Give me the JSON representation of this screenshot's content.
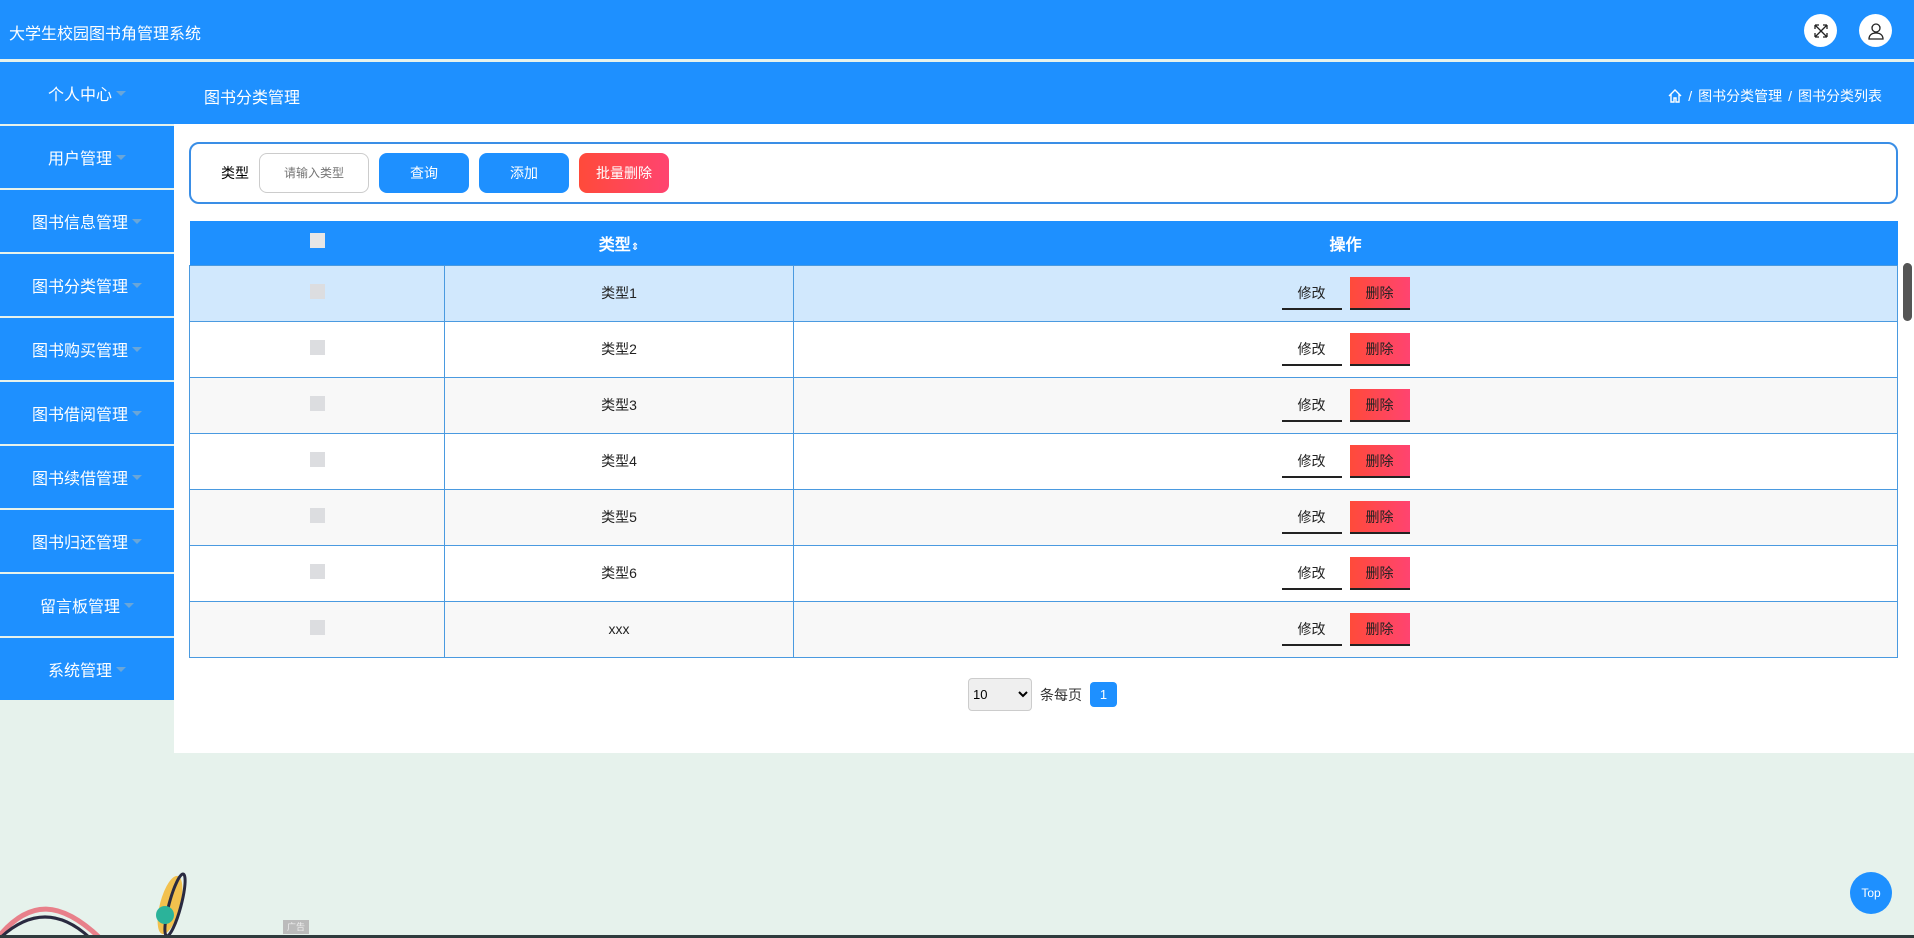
{
  "header": {
    "title": "大学生校园图书角管理系统",
    "icons": [
      "fullscreen-icon",
      "user-icon"
    ]
  },
  "subheader": {
    "page_title": "图书分类管理",
    "breadcrumb": [
      "图书分类管理",
      "图书分类列表"
    ]
  },
  "sidebar": {
    "items": [
      {
        "label": "个人中心"
      },
      {
        "label": "用户管理"
      },
      {
        "label": "图书信息管理"
      },
      {
        "label": "图书分类管理"
      },
      {
        "label": "图书购买管理"
      },
      {
        "label": "图书借阅管理"
      },
      {
        "label": "图书续借管理"
      },
      {
        "label": "图书归还管理"
      },
      {
        "label": "留言板管理"
      },
      {
        "label": "系统管理"
      }
    ]
  },
  "search": {
    "label": "类型",
    "placeholder": "请输入类型",
    "value": "",
    "query": "查询",
    "add": "添加",
    "batch_delete": "批量删除"
  },
  "table": {
    "headers": {
      "type": "类型",
      "action": "操作"
    },
    "rows": [
      {
        "type": "类型1"
      },
      {
        "type": "类型2"
      },
      {
        "type": "类型3"
      },
      {
        "type": "类型4"
      },
      {
        "type": "类型5"
      },
      {
        "type": "类型6"
      },
      {
        "type": "xxx"
      }
    ],
    "edit": "修改",
    "delete": "删除"
  },
  "pagination": {
    "page_size": "10",
    "per_page_label": "条每页",
    "current_page": "1"
  },
  "top_button": "Top",
  "ad_label": "广告",
  "colors": {
    "primary": "#1e90ff",
    "danger": "#ff4a3a",
    "background": "#e6f2ec"
  }
}
